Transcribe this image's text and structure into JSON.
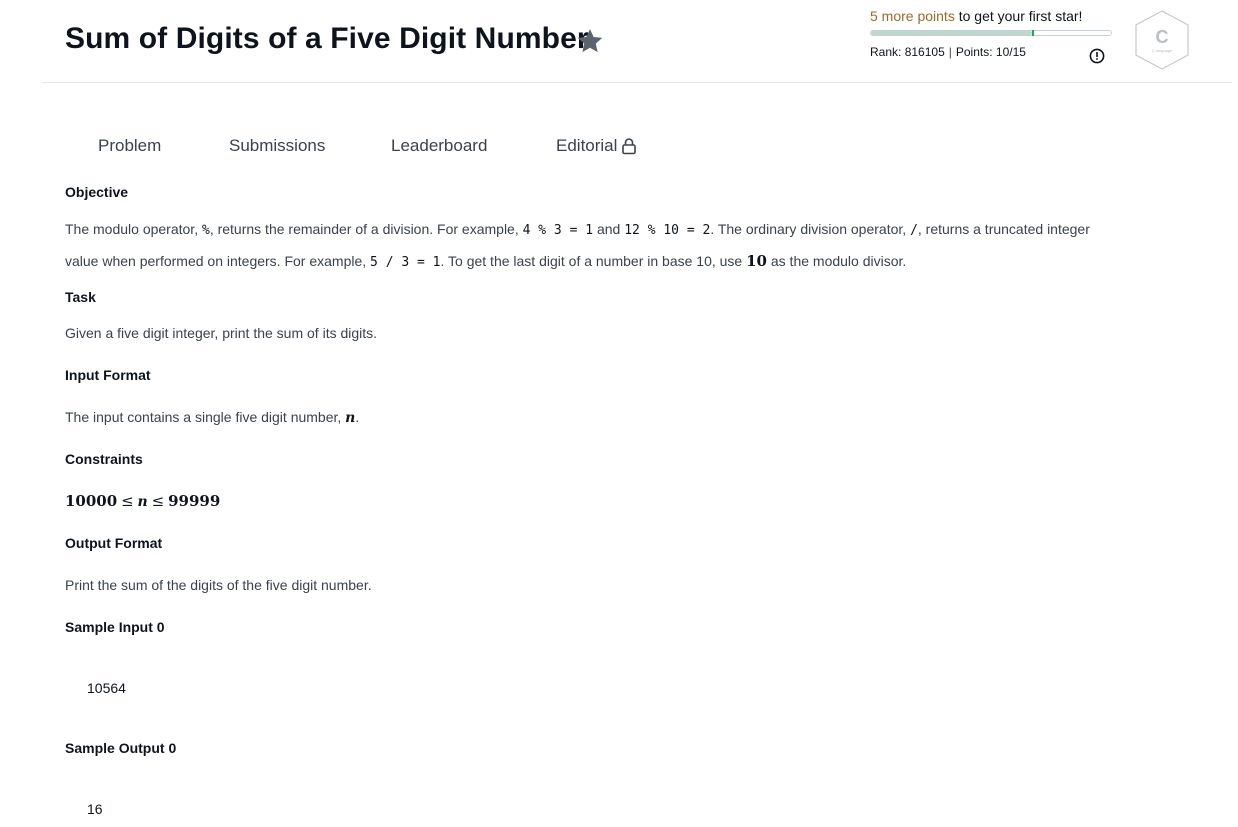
{
  "header": {
    "title": "Sum of Digits of a Five Digit Number",
    "progress_points": "5 more points",
    "progress_rest": " to get your first star!",
    "progress_fraction": 0.67,
    "rank_label": "Rank:",
    "rank_value": "816105",
    "points_label": "Points:",
    "points_value": "10/15",
    "badge_letter": "C",
    "badge_sub": "C language",
    "star_icon": "star-icon",
    "alert_icon": "alert-circle-icon"
  },
  "tabs": [
    {
      "label": "Problem"
    },
    {
      "label": "Submissions"
    },
    {
      "label": "Leaderboard"
    },
    {
      "label": "Editorial"
    }
  ],
  "content": {
    "objective_heading": "Objective",
    "obj_l1_a": "The modulo operator, ",
    "obj_l1_code1": "%",
    "obj_l1_b": ", returns the remainder of a division. For example, ",
    "obj_l1_code2": "4 % 3 = 1",
    "obj_l1_c": " and ",
    "obj_l1_code3": "12 % 10 = 2",
    "obj_l1_d": ". The ordinary division operator, ",
    "obj_l1_code4": "/",
    "obj_l1_e": ", returns a truncated integer",
    "obj_l2_a": "value when performed on integers. For example, ",
    "obj_l2_code1": "5 / 3 = 1",
    "obj_l2_b": ". To get the last digit of a number in base 10, use ",
    "obj_l2_math": "10",
    "obj_l2_c": " as the modulo divisor.",
    "task_heading": "Task",
    "task_text": "Given a five digit integer, print the sum of its digits.",
    "input_heading": "Input Format",
    "input_text_a": "The input contains a single five digit number, ",
    "input_var": "n",
    "input_text_b": ".",
    "constraints_heading": "Constraints",
    "constraint_low": "10000",
    "constraint_le1": "≤",
    "constraint_var": "n",
    "constraint_le2": "≤",
    "constraint_high": "99999",
    "output_heading": "Output Format",
    "output_text": "Print the sum of the digits of the five digit number.",
    "sample_input_heading": "Sample Input 0",
    "sample_input_value": "10564",
    "sample_output_heading": "Sample Output 0",
    "sample_output_value": "16"
  }
}
